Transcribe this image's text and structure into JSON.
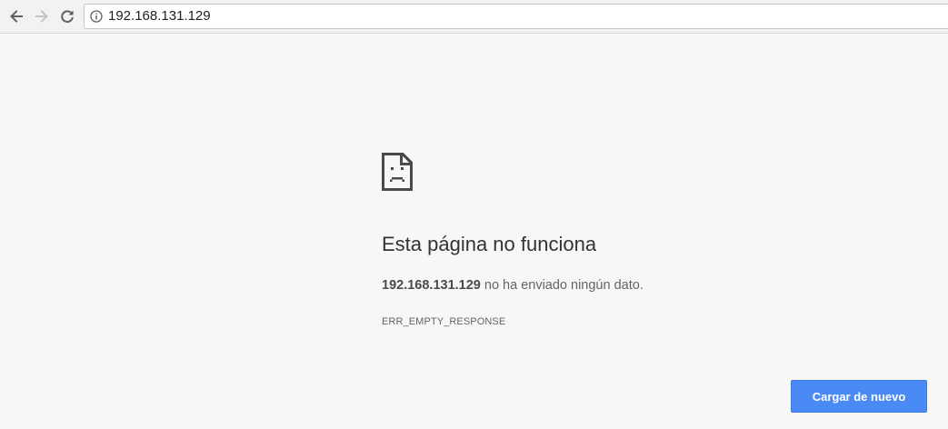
{
  "browser": {
    "url": "192.168.131.129",
    "icons": {
      "back": "back-arrow-icon",
      "forward": "forward-arrow-icon",
      "reload": "reload-icon",
      "site_info": "info-icon"
    }
  },
  "error": {
    "icon": "sad-page-icon",
    "title": "Esta página no funciona",
    "host": "192.168.131.129",
    "message": " no ha enviado ningún dato.",
    "code": "ERR_EMPTY_RESPONSE",
    "reload_label": "Cargar de nuevo"
  },
  "colors": {
    "page_background": "#f7f7f7",
    "button_blue": "#4a8af4",
    "title_text": "#333333",
    "body_text": "#646464"
  }
}
